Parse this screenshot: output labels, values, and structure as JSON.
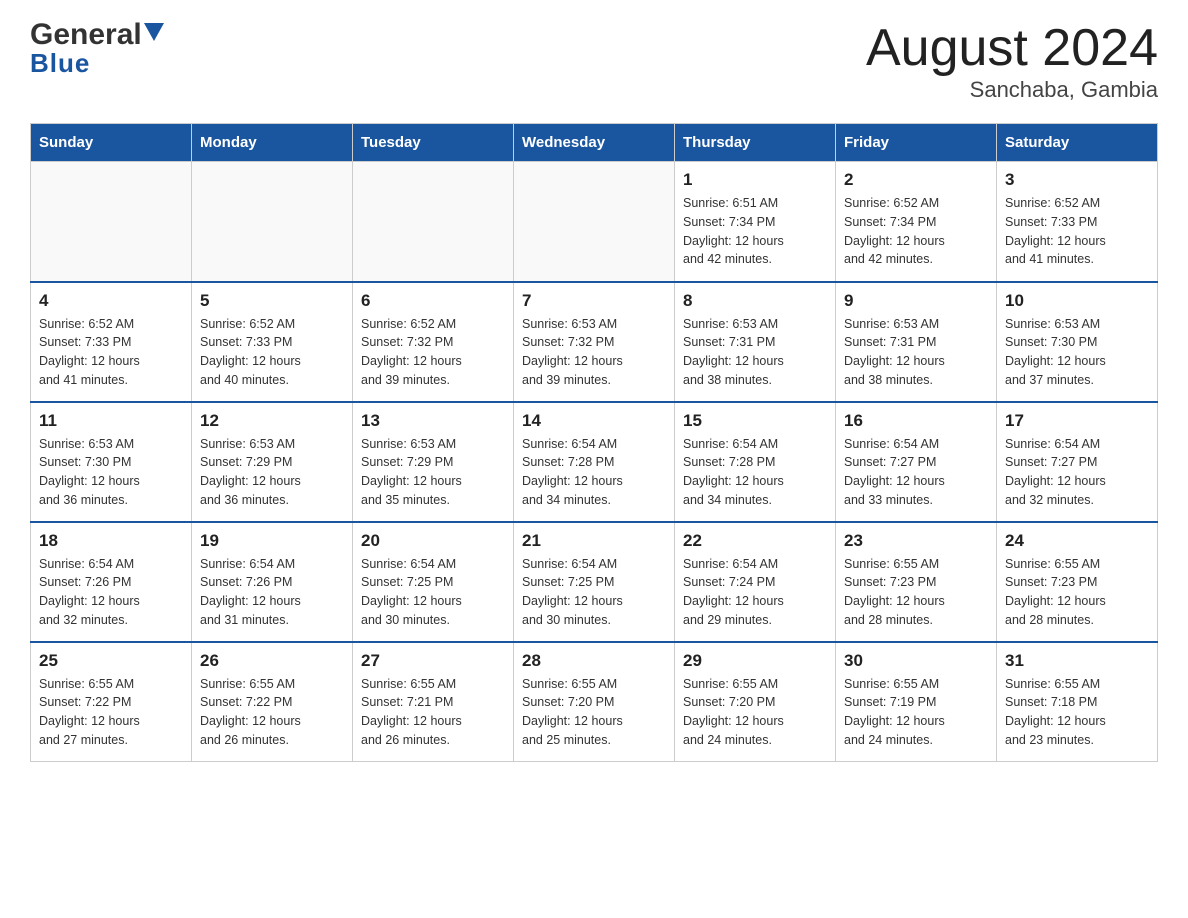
{
  "logo": {
    "text1": "General",
    "text2": "Blue"
  },
  "title": "August 2024",
  "subtitle": "Sanchaba, Gambia",
  "days_of_week": [
    "Sunday",
    "Monday",
    "Tuesday",
    "Wednesday",
    "Thursday",
    "Friday",
    "Saturday"
  ],
  "weeks": [
    [
      {
        "day": "",
        "info": ""
      },
      {
        "day": "",
        "info": ""
      },
      {
        "day": "",
        "info": ""
      },
      {
        "day": "",
        "info": ""
      },
      {
        "day": "1",
        "info": "Sunrise: 6:51 AM\nSunset: 7:34 PM\nDaylight: 12 hours\nand 42 minutes."
      },
      {
        "day": "2",
        "info": "Sunrise: 6:52 AM\nSunset: 7:34 PM\nDaylight: 12 hours\nand 42 minutes."
      },
      {
        "day": "3",
        "info": "Sunrise: 6:52 AM\nSunset: 7:33 PM\nDaylight: 12 hours\nand 41 minutes."
      }
    ],
    [
      {
        "day": "4",
        "info": "Sunrise: 6:52 AM\nSunset: 7:33 PM\nDaylight: 12 hours\nand 41 minutes."
      },
      {
        "day": "5",
        "info": "Sunrise: 6:52 AM\nSunset: 7:33 PM\nDaylight: 12 hours\nand 40 minutes."
      },
      {
        "day": "6",
        "info": "Sunrise: 6:52 AM\nSunset: 7:32 PM\nDaylight: 12 hours\nand 39 minutes."
      },
      {
        "day": "7",
        "info": "Sunrise: 6:53 AM\nSunset: 7:32 PM\nDaylight: 12 hours\nand 39 minutes."
      },
      {
        "day": "8",
        "info": "Sunrise: 6:53 AM\nSunset: 7:31 PM\nDaylight: 12 hours\nand 38 minutes."
      },
      {
        "day": "9",
        "info": "Sunrise: 6:53 AM\nSunset: 7:31 PM\nDaylight: 12 hours\nand 38 minutes."
      },
      {
        "day": "10",
        "info": "Sunrise: 6:53 AM\nSunset: 7:30 PM\nDaylight: 12 hours\nand 37 minutes."
      }
    ],
    [
      {
        "day": "11",
        "info": "Sunrise: 6:53 AM\nSunset: 7:30 PM\nDaylight: 12 hours\nand 36 minutes."
      },
      {
        "day": "12",
        "info": "Sunrise: 6:53 AM\nSunset: 7:29 PM\nDaylight: 12 hours\nand 36 minutes."
      },
      {
        "day": "13",
        "info": "Sunrise: 6:53 AM\nSunset: 7:29 PM\nDaylight: 12 hours\nand 35 minutes."
      },
      {
        "day": "14",
        "info": "Sunrise: 6:54 AM\nSunset: 7:28 PM\nDaylight: 12 hours\nand 34 minutes."
      },
      {
        "day": "15",
        "info": "Sunrise: 6:54 AM\nSunset: 7:28 PM\nDaylight: 12 hours\nand 34 minutes."
      },
      {
        "day": "16",
        "info": "Sunrise: 6:54 AM\nSunset: 7:27 PM\nDaylight: 12 hours\nand 33 minutes."
      },
      {
        "day": "17",
        "info": "Sunrise: 6:54 AM\nSunset: 7:27 PM\nDaylight: 12 hours\nand 32 minutes."
      }
    ],
    [
      {
        "day": "18",
        "info": "Sunrise: 6:54 AM\nSunset: 7:26 PM\nDaylight: 12 hours\nand 32 minutes."
      },
      {
        "day": "19",
        "info": "Sunrise: 6:54 AM\nSunset: 7:26 PM\nDaylight: 12 hours\nand 31 minutes."
      },
      {
        "day": "20",
        "info": "Sunrise: 6:54 AM\nSunset: 7:25 PM\nDaylight: 12 hours\nand 30 minutes."
      },
      {
        "day": "21",
        "info": "Sunrise: 6:54 AM\nSunset: 7:25 PM\nDaylight: 12 hours\nand 30 minutes."
      },
      {
        "day": "22",
        "info": "Sunrise: 6:54 AM\nSunset: 7:24 PM\nDaylight: 12 hours\nand 29 minutes."
      },
      {
        "day": "23",
        "info": "Sunrise: 6:55 AM\nSunset: 7:23 PM\nDaylight: 12 hours\nand 28 minutes."
      },
      {
        "day": "24",
        "info": "Sunrise: 6:55 AM\nSunset: 7:23 PM\nDaylight: 12 hours\nand 28 minutes."
      }
    ],
    [
      {
        "day": "25",
        "info": "Sunrise: 6:55 AM\nSunset: 7:22 PM\nDaylight: 12 hours\nand 27 minutes."
      },
      {
        "day": "26",
        "info": "Sunrise: 6:55 AM\nSunset: 7:22 PM\nDaylight: 12 hours\nand 26 minutes."
      },
      {
        "day": "27",
        "info": "Sunrise: 6:55 AM\nSunset: 7:21 PM\nDaylight: 12 hours\nand 26 minutes."
      },
      {
        "day": "28",
        "info": "Sunrise: 6:55 AM\nSunset: 7:20 PM\nDaylight: 12 hours\nand 25 minutes."
      },
      {
        "day": "29",
        "info": "Sunrise: 6:55 AM\nSunset: 7:20 PM\nDaylight: 12 hours\nand 24 minutes."
      },
      {
        "day": "30",
        "info": "Sunrise: 6:55 AM\nSunset: 7:19 PM\nDaylight: 12 hours\nand 24 minutes."
      },
      {
        "day": "31",
        "info": "Sunrise: 6:55 AM\nSunset: 7:18 PM\nDaylight: 12 hours\nand 23 minutes."
      }
    ]
  ]
}
